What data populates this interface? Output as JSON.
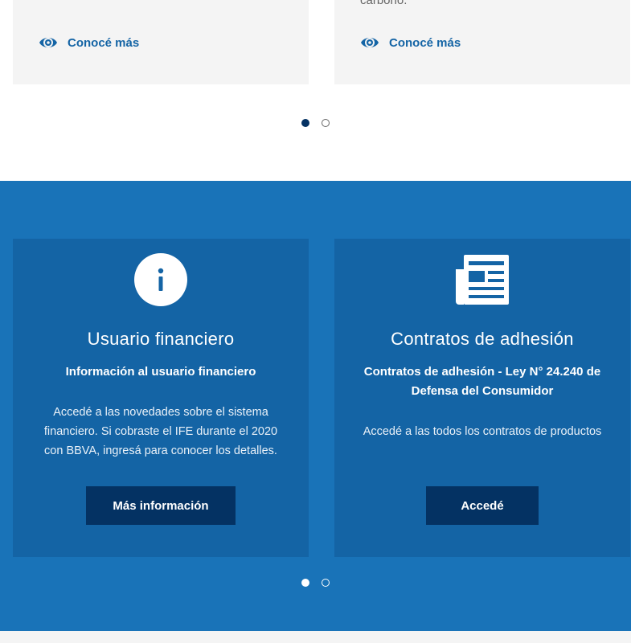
{
  "promo": {
    "cut_text_right": "carbono.",
    "cards": [
      {
        "link_label": "Conocé más"
      },
      {
        "link_label": "Conocé más"
      }
    ]
  },
  "info": {
    "cards": [
      {
        "icon": "info-icon",
        "title": "Usuario financiero",
        "subtitle": "Información al usuario financiero",
        "description": "Accedé a las novedades sobre el sistema financiero. Si cobraste el IFE durante el 2020 con BBVA, ingresá para conocer los detalles.",
        "button_label": "Más información"
      },
      {
        "icon": "newspaper-icon",
        "title": "Contratos de adhesión",
        "subtitle": "Contratos de adhesión - Ley N° 24.240 de Defensa del Consumidor",
        "description": "Accedé a las todos los contratos de productos",
        "button_label": "Accedé"
      }
    ]
  },
  "carousel_top": {
    "active": 1,
    "count": 2
  },
  "carousel_bottom": {
    "active": 1,
    "count": 2
  },
  "colors": {
    "brand_blue": "#1973b8",
    "card_blue": "#1464a5",
    "navy": "#043263",
    "light_gray": "#f4f4f4"
  }
}
